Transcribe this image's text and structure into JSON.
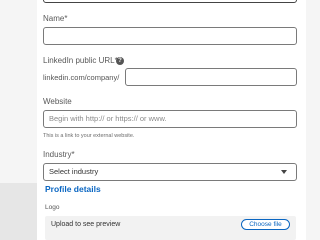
{
  "form": {
    "name_label": "Name*",
    "linkedin_label": "LinkedIn public URL*",
    "linkedin_prefix": "linkedin.com/company/",
    "website_label": "Website",
    "website_placeholder": "Begin with http:// or https:// or www.",
    "website_helper": "This is a link to your external website.",
    "industry_label": "Industry*",
    "industry_selected": "Select industry"
  },
  "profile": {
    "section_title": "Profile details",
    "logo_label": "Logo",
    "upload_text": "Upload to see preview",
    "choose_file_label": "Choose file"
  },
  "colors": {
    "accent": "#0a66c2"
  }
}
